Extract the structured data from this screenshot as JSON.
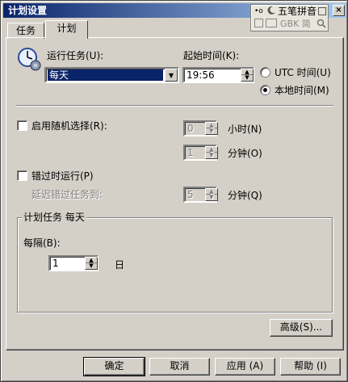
{
  "window": {
    "title": "计划设置",
    "close_glyph": "×"
  },
  "ime": {
    "name": "五笔拼音",
    "row1_icons": "•o",
    "row2_label": "GBK 简"
  },
  "tabs": [
    {
      "label": "任务",
      "active": false
    },
    {
      "label": "计划",
      "active": true
    }
  ],
  "schedule": {
    "task_label": "运行任务(U):",
    "task_value": "每天",
    "start_time_label": "起始时间(K):",
    "start_time_value": "19:56",
    "utc_label": "UTC 时间(U)",
    "local_label": "本地时间(M)",
    "selected_timezone": "local"
  },
  "random": {
    "checkbox_label": "启用随机选择(R):",
    "checked": false,
    "hours_value": "0",
    "hours_unit": "小时(N)",
    "minutes_value": "1",
    "minutes_unit": "分钟(O)"
  },
  "missed": {
    "checkbox_label": "错过时运行(P)",
    "checked": false,
    "delay_label": "延迟错过任务到:",
    "delay_value": "5",
    "delay_unit": "分钟(Q)"
  },
  "daily": {
    "group_title": "计划任务 每天",
    "every_label": "每隔(B):",
    "every_value": "1",
    "every_unit": "日"
  },
  "buttons": {
    "advanced": "高级(S)...",
    "ok": "确定",
    "cancel": "取消",
    "apply": "应用 (A)",
    "help": "帮助 (I)"
  },
  "icons": {
    "clock_gear": "clock-gear-icon",
    "combo_arrow": "▼",
    "spin_up": "▲",
    "spin_down": "▼"
  }
}
